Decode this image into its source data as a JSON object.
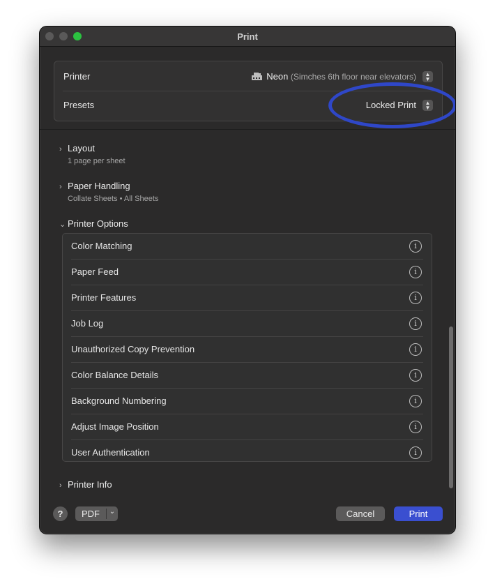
{
  "window": {
    "title": "Print"
  },
  "printer": {
    "label": "Printer",
    "name": "Neon",
    "location": "(Simches 6th floor near elevators)",
    "icon": "printer-icon"
  },
  "presets": {
    "label": "Presets",
    "value": "Locked Print"
  },
  "sections": {
    "layout": {
      "title": "Layout",
      "summary": "1 page per sheet"
    },
    "paper_handling": {
      "title": "Paper Handling",
      "summary": "Collate Sheets • All Sheets"
    },
    "printer_options": {
      "title": "Printer Options",
      "items": [
        {
          "label": "Color Matching"
        },
        {
          "label": "Paper Feed"
        },
        {
          "label": "Printer Features"
        },
        {
          "label": "Job Log"
        },
        {
          "label": "Unauthorized Copy Prevention"
        },
        {
          "label": "Color Balance Details"
        },
        {
          "label": "Background Numbering"
        },
        {
          "label": "Adjust Image Position"
        },
        {
          "label": "User Authentication"
        }
      ]
    },
    "printer_info": {
      "title": "Printer Info"
    }
  },
  "footer": {
    "help_label": "?",
    "pdf_label": "PDF",
    "cancel_label": "Cancel",
    "print_label": "Print"
  },
  "glyphs": {
    "collapsed": "›",
    "expanded": "⌄",
    "info": "i",
    "stepper_up": "▲",
    "stepper_down": "▼",
    "pdf_menu": "⌄"
  },
  "colors": {
    "accent": "#3a4fd0",
    "highlight_ring": "#2f47c8",
    "window_bg": "#2b2a2a",
    "zoom_button": "#2bc140"
  }
}
